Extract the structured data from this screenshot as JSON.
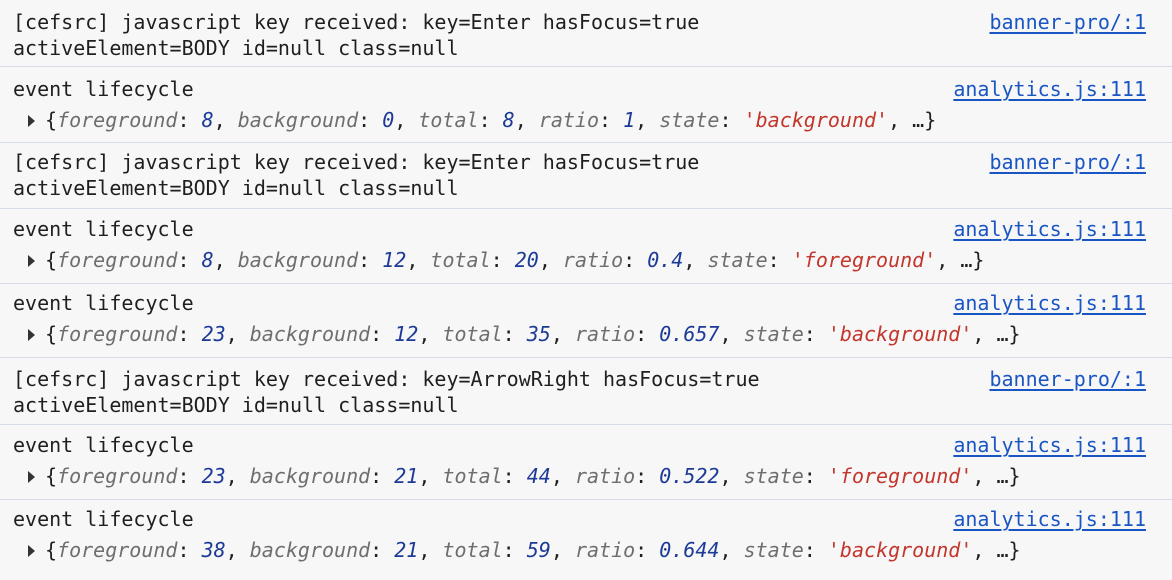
{
  "console": {
    "entries": [
      {
        "type": "text",
        "line1": "[cefsrc] javascript key received: key=Enter hasFocus=true",
        "line2": "activeElement=BODY id=null class=null",
        "source": "banner-pro/:1"
      },
      {
        "type": "object",
        "line1": "event lifecycle",
        "source": "analytics.js:111",
        "obj": {
          "foreground": "8",
          "background": "0",
          "total": "8",
          "ratio": "1",
          "state": "'background'"
        }
      },
      {
        "type": "text",
        "line1": "[cefsrc] javascript key received: key=Enter hasFocus=true",
        "line2": "activeElement=BODY id=null class=null",
        "source": "banner-pro/:1"
      },
      {
        "type": "object",
        "line1": "event lifecycle",
        "source": "analytics.js:111",
        "obj": {
          "foreground": "8",
          "background": "12",
          "total": "20",
          "ratio": "0.4",
          "state": "'foreground'"
        }
      },
      {
        "type": "object",
        "line1": "event lifecycle",
        "source": "analytics.js:111",
        "obj": {
          "foreground": "23",
          "background": "12",
          "total": "35",
          "ratio": "0.657",
          "state": "'background'"
        }
      },
      {
        "type": "text",
        "line1": "[cefsrc] javascript key received: key=ArrowRight hasFocus=true",
        "line2": "activeElement=BODY id=null class=null",
        "source": "banner-pro/:1"
      },
      {
        "type": "object",
        "line1": "event lifecycle",
        "source": "analytics.js:111",
        "obj": {
          "foreground": "23",
          "background": "21",
          "total": "44",
          "ratio": "0.522",
          "state": "'foreground'"
        }
      },
      {
        "type": "object",
        "line1": "event lifecycle",
        "source": "analytics.js:111",
        "obj": {
          "foreground": "38",
          "background": "21",
          "total": "59",
          "ratio": "0.644",
          "state": "'background'"
        }
      }
    ],
    "labels": {
      "k_foreground": "foreground",
      "k_background": "background",
      "k_total": "total",
      "k_ratio": "ratio",
      "k_state": "state",
      "open_brace": "{",
      "close_brace": "…}",
      "colon": ": ",
      "comma": ", "
    }
  }
}
